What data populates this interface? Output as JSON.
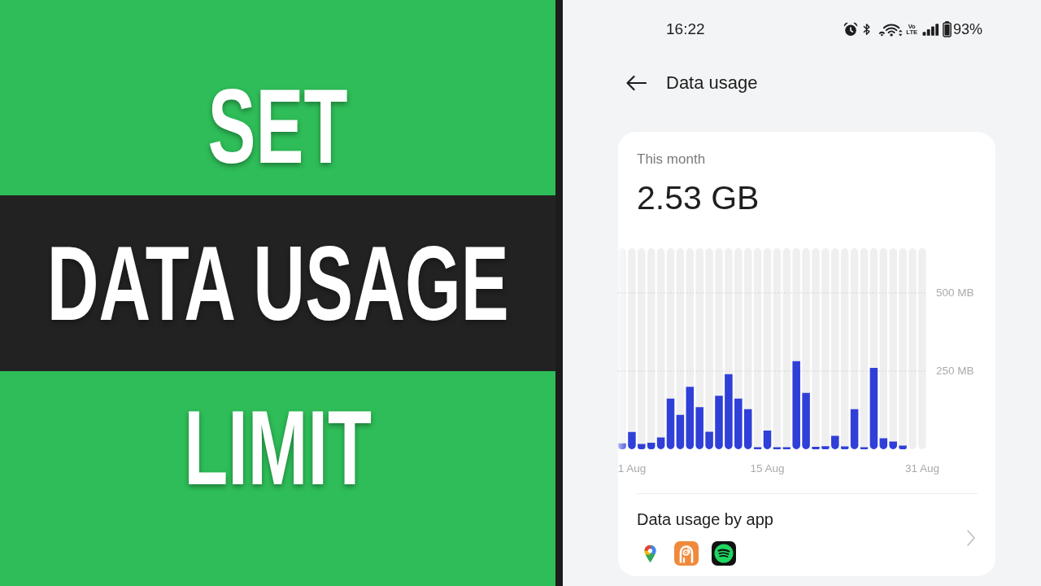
{
  "banner": {
    "line_above_band": "SET",
    "band_text": "DATA USAGE",
    "line_below_band": "LIMIT"
  },
  "status_bar": {
    "time": "16:22",
    "network_top": "Vo",
    "network_bottom": "LTE",
    "battery": "93%"
  },
  "header": {
    "title": "Data usage"
  },
  "summary": {
    "period_label": "This month",
    "total": "2.53 GB",
    "chart_data": {
      "type": "bar",
      "categories": [
        null,
        "1 Aug",
        null,
        null,
        null,
        null,
        null,
        null,
        null,
        null,
        null,
        null,
        null,
        null,
        null,
        "15 Aug",
        null,
        null,
        null,
        null,
        null,
        null,
        null,
        null,
        null,
        null,
        null,
        null,
        null,
        null,
        null,
        "31 Aug"
      ],
      "values": [
        19,
        55,
        17,
        21,
        38,
        162,
        110,
        200,
        135,
        56,
        171,
        240,
        162,
        128,
        4,
        60,
        3,
        3,
        282,
        180,
        8,
        10,
        43,
        9,
        128,
        4,
        260,
        35,
        25,
        12,
        null,
        null
      ],
      "ylim": [
        0,
        643
      ],
      "yticks": [
        {
          "value": 250,
          "label": "250 MB"
        },
        {
          "value": 500,
          "label": "500 MB"
        }
      ]
    }
  },
  "apps_usage": {
    "title": "Data usage by app",
    "apps": [
      {
        "kind": "pin"
      },
      {
        "kind": "broadcast"
      },
      {
        "kind": "arcs"
      }
    ]
  }
}
